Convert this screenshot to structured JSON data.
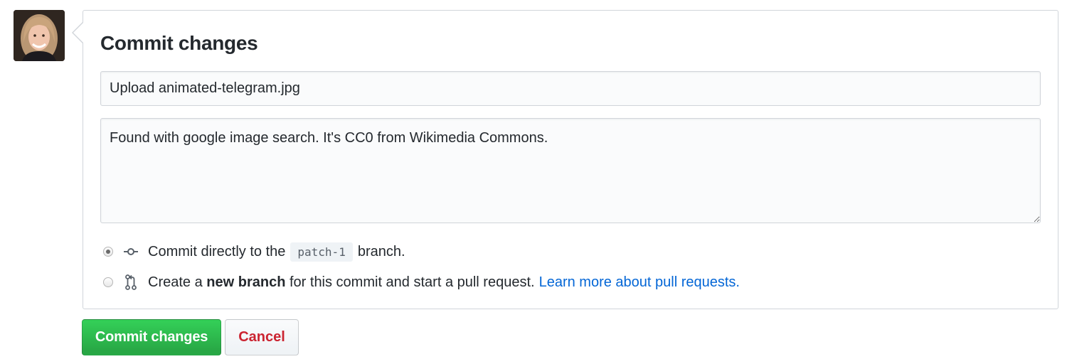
{
  "avatar": {
    "icon": "user-avatar"
  },
  "commit_panel": {
    "title": "Commit changes",
    "summary_value": "Upload animated-telegram.jpg",
    "description_value": "Found with google image search. It's CC0 from Wikimedia Commons.",
    "options": [
      {
        "checked": true,
        "icon": "git-commit-icon",
        "text_before": "Commit directly to the",
        "branch": "patch-1",
        "text_after": "branch."
      },
      {
        "checked": false,
        "icon": "git-pull-request-icon",
        "text_before": "Create a",
        "bold_text": "new branch",
        "text_after": "for this commit and start a pull request.",
        "link_text": "Learn more about pull requests."
      }
    ]
  },
  "buttons": {
    "commit_label": "Commit changes",
    "cancel_label": "Cancel"
  },
  "colors": {
    "primary_green": "#28a745",
    "link_blue": "#0366d6",
    "danger_red": "#cb2431",
    "border": "#d1d5da"
  }
}
